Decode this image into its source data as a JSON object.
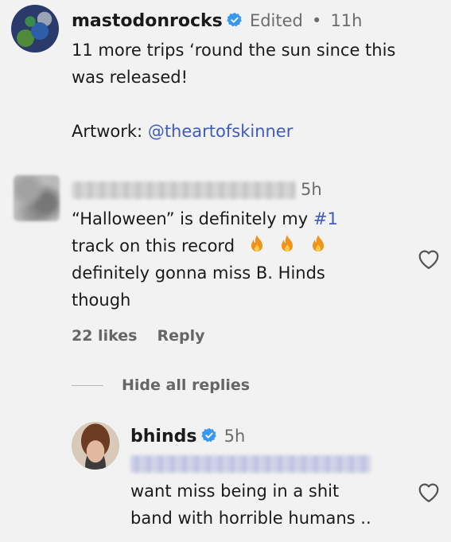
{
  "post": {
    "username": "mastodonrocks",
    "edited_label": "Edited",
    "separator": "•",
    "time": "11h",
    "line1": "11 more trips ‘round the sun since this",
    "line2": "was released!",
    "artwork_label": "Artwork: ",
    "artwork_handle": "@theartofskinner"
  },
  "comment": {
    "time": "5h",
    "line1_prefix": "“Halloween” is definitely my ",
    "hashtag": "#1",
    "line2": "track on this record",
    "emoji": "fire-emoji",
    "emoji_count": 3,
    "line3": "definitely gonna miss B. Hinds",
    "line4": "though",
    "likes": "22 likes",
    "reply_label": "Reply"
  },
  "replies_toggle": {
    "label": "Hide all replies"
  },
  "reply": {
    "username": "bhinds",
    "time": "5h",
    "line1": "want miss being in a shit",
    "line2": "band with horrible humans .."
  },
  "colors": {
    "background": "#f2f2f2",
    "link": "#3f5bbf",
    "verified": "#3897f0",
    "flame": "#f0931a"
  }
}
